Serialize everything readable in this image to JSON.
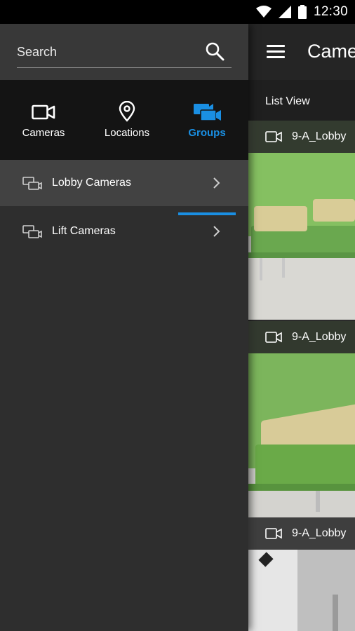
{
  "status_bar": {
    "time": "12:30",
    "icons": [
      "wifi-icon",
      "signal-icon",
      "battery-icon"
    ]
  },
  "main": {
    "title": "Came",
    "view_mode": "List View",
    "cameras": [
      {
        "name": "9-A_Lobby"
      },
      {
        "name": "9-A_Lobby"
      },
      {
        "name": "9-A_Lobby"
      }
    ]
  },
  "drawer": {
    "search": {
      "placeholder": "Search"
    },
    "tabs": [
      {
        "label": "Cameras",
        "icon": "camera-icon",
        "active": false
      },
      {
        "label": "Locations",
        "icon": "location-pin-icon",
        "active": false
      },
      {
        "label": "Groups",
        "icon": "camera-group-icon",
        "active": true
      }
    ],
    "groups": [
      {
        "label": "Lobby Cameras",
        "selected": true
      },
      {
        "label": "Lift Cameras",
        "selected": false
      }
    ]
  },
  "colors": {
    "accent": "#1a8fe3",
    "drawer_bg": "#2e2e2e",
    "tabs_bg": "#141414",
    "wall_green": "#7bb85a"
  }
}
